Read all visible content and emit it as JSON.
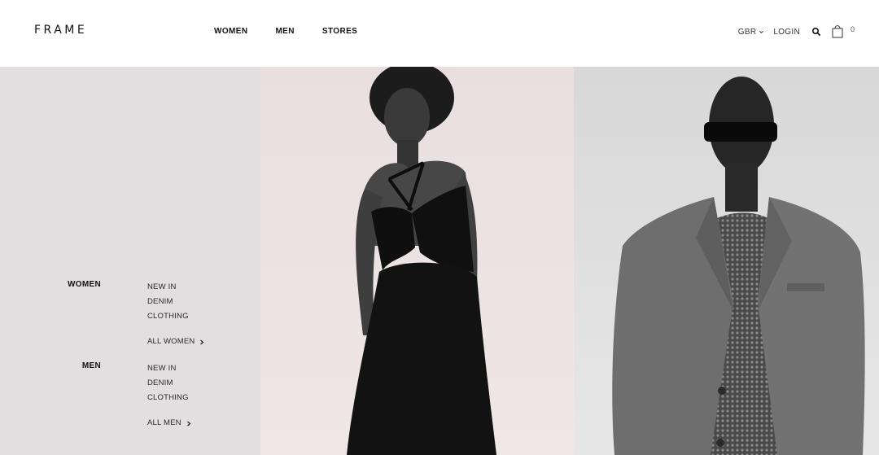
{
  "header": {
    "logo": "FRAME",
    "nav": [
      {
        "label": "WOMEN"
      },
      {
        "label": "MEN"
      },
      {
        "label": "STORES"
      }
    ],
    "currency": "GBR",
    "login": "LOGIN",
    "cart_count": "0",
    "icons": {
      "currency_chevron": "chevron-down-icon",
      "search": "search-icon",
      "cart": "shopping-bag-icon"
    }
  },
  "menu": {
    "women": {
      "title": "WOMEN",
      "links": [
        "NEW IN",
        "DENIM",
        "CLOTHING"
      ],
      "all": "ALL WOMEN"
    },
    "men": {
      "title": "MEN",
      "links": [
        "NEW IN",
        "DENIM",
        "CLOTHING"
      ],
      "all": "ALL MEN"
    }
  },
  "colors": {
    "menu_panel_bg": "#e3dfe0",
    "women_photo_bg": "#ede4e4",
    "men_photo_bg": "#dcdcdc"
  }
}
